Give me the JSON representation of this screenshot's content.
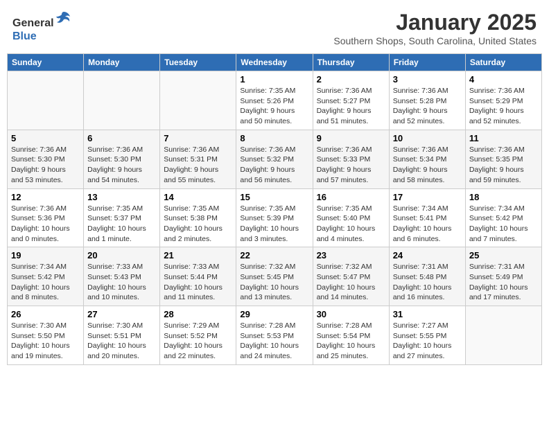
{
  "header": {
    "logo_line1": "General",
    "logo_line2": "Blue",
    "month": "January 2025",
    "location": "Southern Shops, South Carolina, United States"
  },
  "weekdays": [
    "Sunday",
    "Monday",
    "Tuesday",
    "Wednesday",
    "Thursday",
    "Friday",
    "Saturday"
  ],
  "weeks": [
    [
      {
        "day": "",
        "info": ""
      },
      {
        "day": "",
        "info": ""
      },
      {
        "day": "",
        "info": ""
      },
      {
        "day": "1",
        "info": "Sunrise: 7:35 AM\nSunset: 5:26 PM\nDaylight: 9 hours\nand 50 minutes."
      },
      {
        "day": "2",
        "info": "Sunrise: 7:36 AM\nSunset: 5:27 PM\nDaylight: 9 hours\nand 51 minutes."
      },
      {
        "day": "3",
        "info": "Sunrise: 7:36 AM\nSunset: 5:28 PM\nDaylight: 9 hours\nand 52 minutes."
      },
      {
        "day": "4",
        "info": "Sunrise: 7:36 AM\nSunset: 5:29 PM\nDaylight: 9 hours\nand 52 minutes."
      }
    ],
    [
      {
        "day": "5",
        "info": "Sunrise: 7:36 AM\nSunset: 5:30 PM\nDaylight: 9 hours\nand 53 minutes."
      },
      {
        "day": "6",
        "info": "Sunrise: 7:36 AM\nSunset: 5:30 PM\nDaylight: 9 hours\nand 54 minutes."
      },
      {
        "day": "7",
        "info": "Sunrise: 7:36 AM\nSunset: 5:31 PM\nDaylight: 9 hours\nand 55 minutes."
      },
      {
        "day": "8",
        "info": "Sunrise: 7:36 AM\nSunset: 5:32 PM\nDaylight: 9 hours\nand 56 minutes."
      },
      {
        "day": "9",
        "info": "Sunrise: 7:36 AM\nSunset: 5:33 PM\nDaylight: 9 hours\nand 57 minutes."
      },
      {
        "day": "10",
        "info": "Sunrise: 7:36 AM\nSunset: 5:34 PM\nDaylight: 9 hours\nand 58 minutes."
      },
      {
        "day": "11",
        "info": "Sunrise: 7:36 AM\nSunset: 5:35 PM\nDaylight: 9 hours\nand 59 minutes."
      }
    ],
    [
      {
        "day": "12",
        "info": "Sunrise: 7:36 AM\nSunset: 5:36 PM\nDaylight: 10 hours\nand 0 minutes."
      },
      {
        "day": "13",
        "info": "Sunrise: 7:35 AM\nSunset: 5:37 PM\nDaylight: 10 hours\nand 1 minute."
      },
      {
        "day": "14",
        "info": "Sunrise: 7:35 AM\nSunset: 5:38 PM\nDaylight: 10 hours\nand 2 minutes."
      },
      {
        "day": "15",
        "info": "Sunrise: 7:35 AM\nSunset: 5:39 PM\nDaylight: 10 hours\nand 3 minutes."
      },
      {
        "day": "16",
        "info": "Sunrise: 7:35 AM\nSunset: 5:40 PM\nDaylight: 10 hours\nand 4 minutes."
      },
      {
        "day": "17",
        "info": "Sunrise: 7:34 AM\nSunset: 5:41 PM\nDaylight: 10 hours\nand 6 minutes."
      },
      {
        "day": "18",
        "info": "Sunrise: 7:34 AM\nSunset: 5:42 PM\nDaylight: 10 hours\nand 7 minutes."
      }
    ],
    [
      {
        "day": "19",
        "info": "Sunrise: 7:34 AM\nSunset: 5:42 PM\nDaylight: 10 hours\nand 8 minutes."
      },
      {
        "day": "20",
        "info": "Sunrise: 7:33 AM\nSunset: 5:43 PM\nDaylight: 10 hours\nand 10 minutes."
      },
      {
        "day": "21",
        "info": "Sunrise: 7:33 AM\nSunset: 5:44 PM\nDaylight: 10 hours\nand 11 minutes."
      },
      {
        "day": "22",
        "info": "Sunrise: 7:32 AM\nSunset: 5:45 PM\nDaylight: 10 hours\nand 13 minutes."
      },
      {
        "day": "23",
        "info": "Sunrise: 7:32 AM\nSunset: 5:47 PM\nDaylight: 10 hours\nand 14 minutes."
      },
      {
        "day": "24",
        "info": "Sunrise: 7:31 AM\nSunset: 5:48 PM\nDaylight: 10 hours\nand 16 minutes."
      },
      {
        "day": "25",
        "info": "Sunrise: 7:31 AM\nSunset: 5:49 PM\nDaylight: 10 hours\nand 17 minutes."
      }
    ],
    [
      {
        "day": "26",
        "info": "Sunrise: 7:30 AM\nSunset: 5:50 PM\nDaylight: 10 hours\nand 19 minutes."
      },
      {
        "day": "27",
        "info": "Sunrise: 7:30 AM\nSunset: 5:51 PM\nDaylight: 10 hours\nand 20 minutes."
      },
      {
        "day": "28",
        "info": "Sunrise: 7:29 AM\nSunset: 5:52 PM\nDaylight: 10 hours\nand 22 minutes."
      },
      {
        "day": "29",
        "info": "Sunrise: 7:28 AM\nSunset: 5:53 PM\nDaylight: 10 hours\nand 24 minutes."
      },
      {
        "day": "30",
        "info": "Sunrise: 7:28 AM\nSunset: 5:54 PM\nDaylight: 10 hours\nand 25 minutes."
      },
      {
        "day": "31",
        "info": "Sunrise: 7:27 AM\nSunset: 5:55 PM\nDaylight: 10 hours\nand 27 minutes."
      },
      {
        "day": "",
        "info": ""
      }
    ]
  ]
}
